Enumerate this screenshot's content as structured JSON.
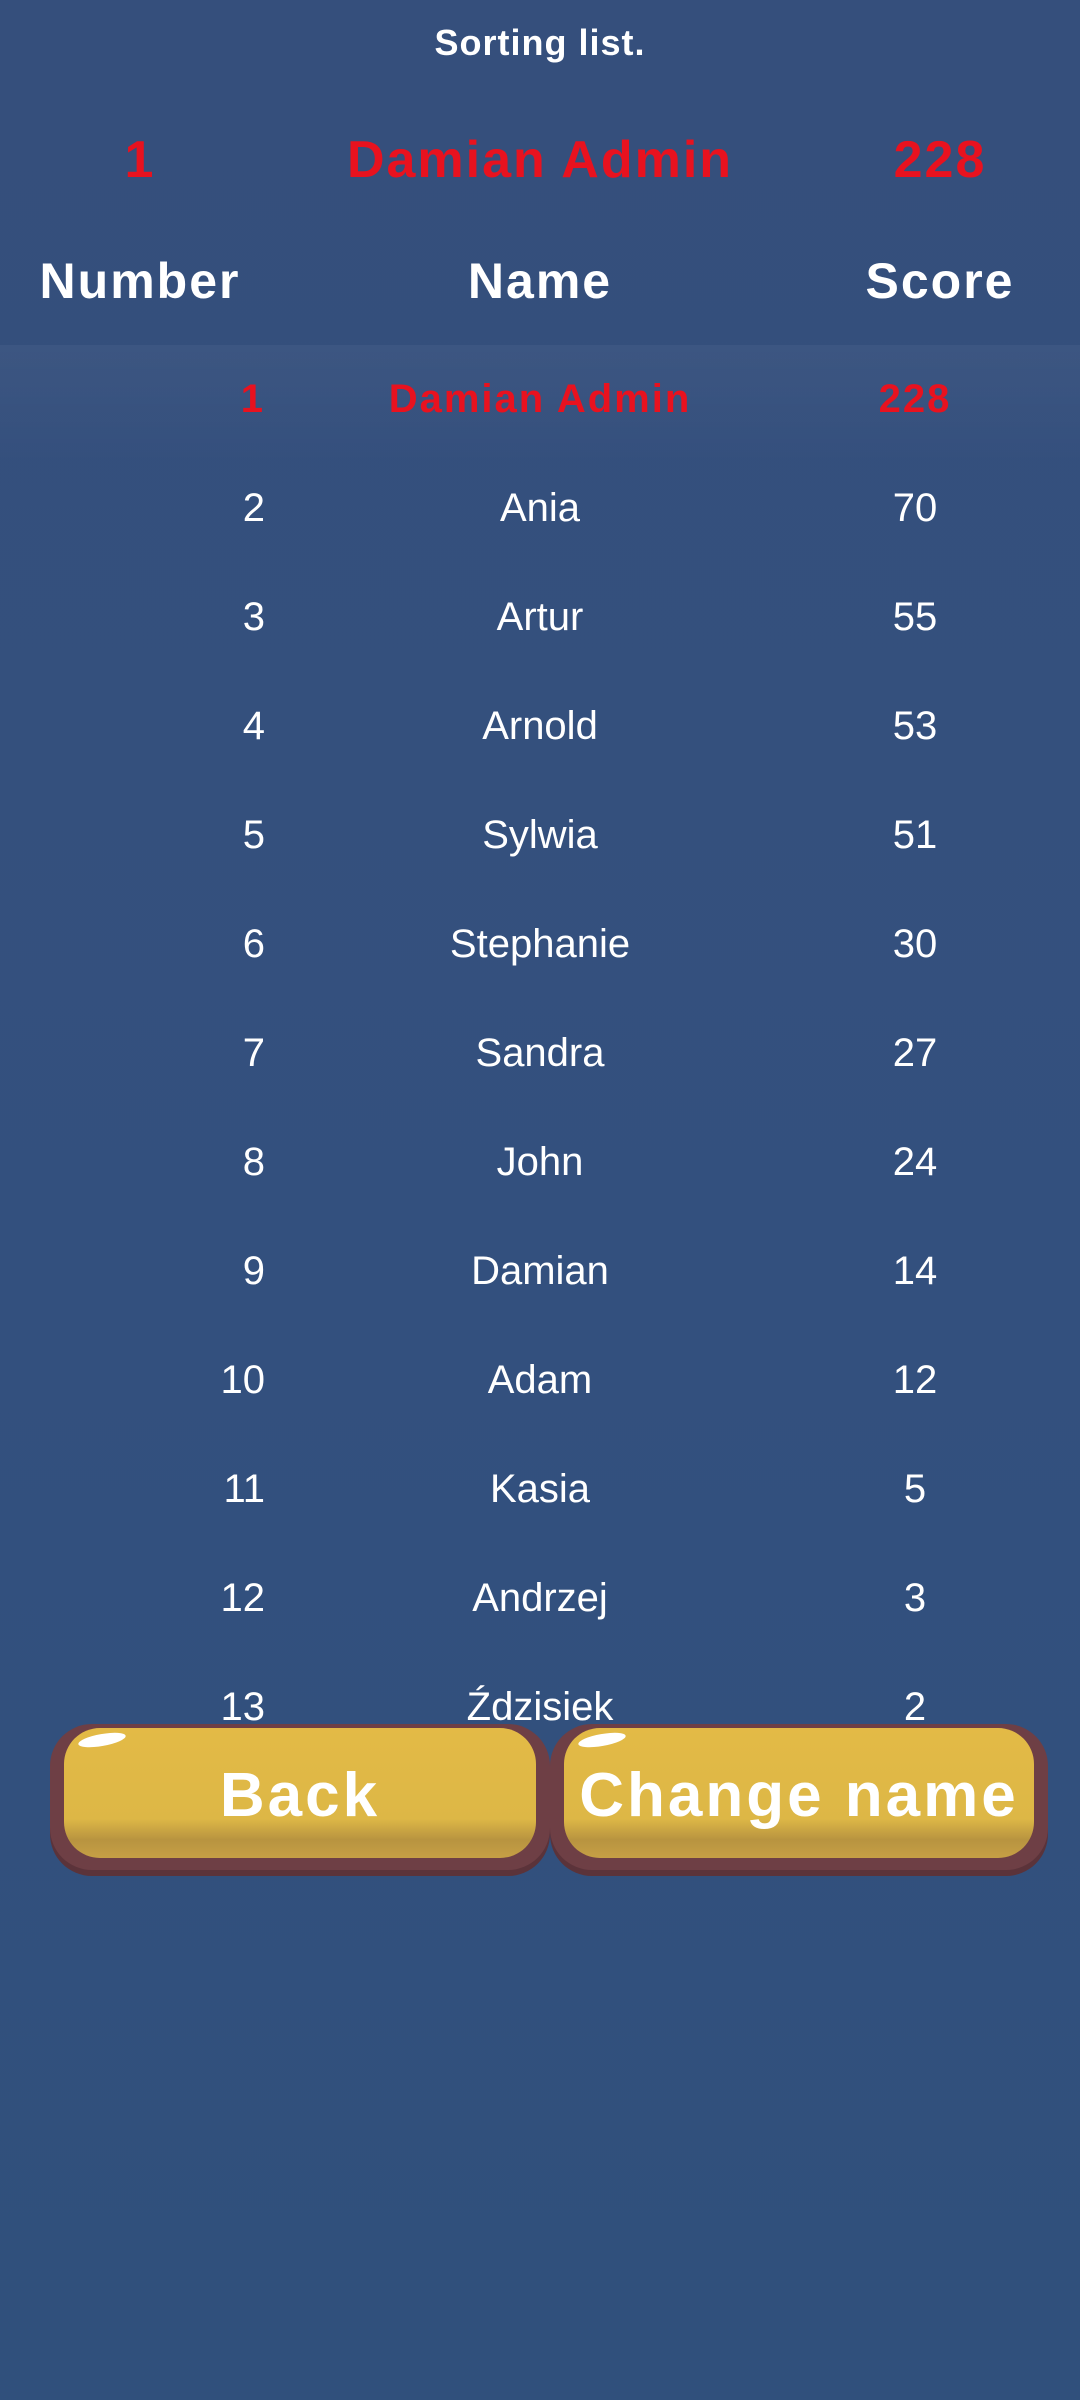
{
  "title": "Sorting list.",
  "current_player": {
    "number": "1",
    "name": "Damian Admin",
    "score": "228"
  },
  "columns": {
    "number": "Number",
    "name": "Name",
    "score": "Score"
  },
  "rows": [
    {
      "number": "1",
      "name": "Damian Admin",
      "score": "228"
    },
    {
      "number": "2",
      "name": "Ania",
      "score": "70"
    },
    {
      "number": "3",
      "name": "Artur",
      "score": "55"
    },
    {
      "number": "4",
      "name": "Arnold",
      "score": "53"
    },
    {
      "number": "5",
      "name": "Sylwia",
      "score": "51"
    },
    {
      "number": "6",
      "name": "Stephanie",
      "score": "30"
    },
    {
      "number": "7",
      "name": "Sandra",
      "score": "27"
    },
    {
      "number": "8",
      "name": "John",
      "score": "24"
    },
    {
      "number": "9",
      "name": "Damian",
      "score": "14"
    },
    {
      "number": "10",
      "name": "Adam",
      "score": "12"
    },
    {
      "number": "11",
      "name": "Kasia",
      "score": "5"
    },
    {
      "number": "12",
      "name": "Andrzej",
      "score": "3"
    },
    {
      "number": "13",
      "name": "Ździsiek",
      "score": "2"
    }
  ],
  "buttons": {
    "back": "Back",
    "change_name": "Change name"
  },
  "colors": {
    "background": "#34507d",
    "highlight": "#e8121f",
    "button_face": "#e0b946",
    "button_border": "#6e3f45"
  }
}
